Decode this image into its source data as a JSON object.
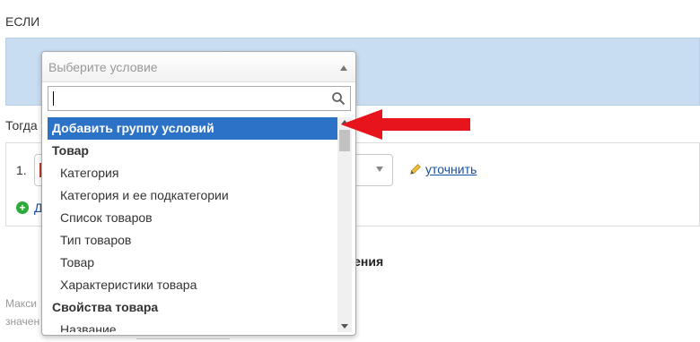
{
  "labels": {
    "if": "ЕСЛИ",
    "then": "Тогда у",
    "row_number": "1.",
    "refine": "уточнить",
    "add": "Д",
    "value_heading": "чения",
    "max": "Макси",
    "value": "значен"
  },
  "dropdown": {
    "placeholder": "Выберите условие",
    "search_value": "",
    "items": [
      {
        "label": "Добавить группу условий",
        "kind": "highlight"
      },
      {
        "label": "Товар",
        "kind": "group"
      },
      {
        "label": "Категория",
        "kind": "child"
      },
      {
        "label": "Категория и ее подкатегории",
        "kind": "child"
      },
      {
        "label": "Список товаров",
        "kind": "child"
      },
      {
        "label": "Тип товаров",
        "kind": "child"
      },
      {
        "label": "Товар",
        "kind": "child"
      },
      {
        "label": "Характеристики товара",
        "kind": "child"
      },
      {
        "label": "Свойства товара",
        "kind": "group"
      },
      {
        "label": "Название",
        "kind": "child"
      }
    ]
  },
  "icons": {
    "search": "search-icon",
    "pencil": "pencil-icon",
    "plus": "plus-circle-icon",
    "arrow": "red-arrow-icon"
  },
  "colors": {
    "highlight": "#2c72c7",
    "band": "#c9ddf2",
    "arrow": "#e8141b",
    "link": "#1a4fa0"
  }
}
